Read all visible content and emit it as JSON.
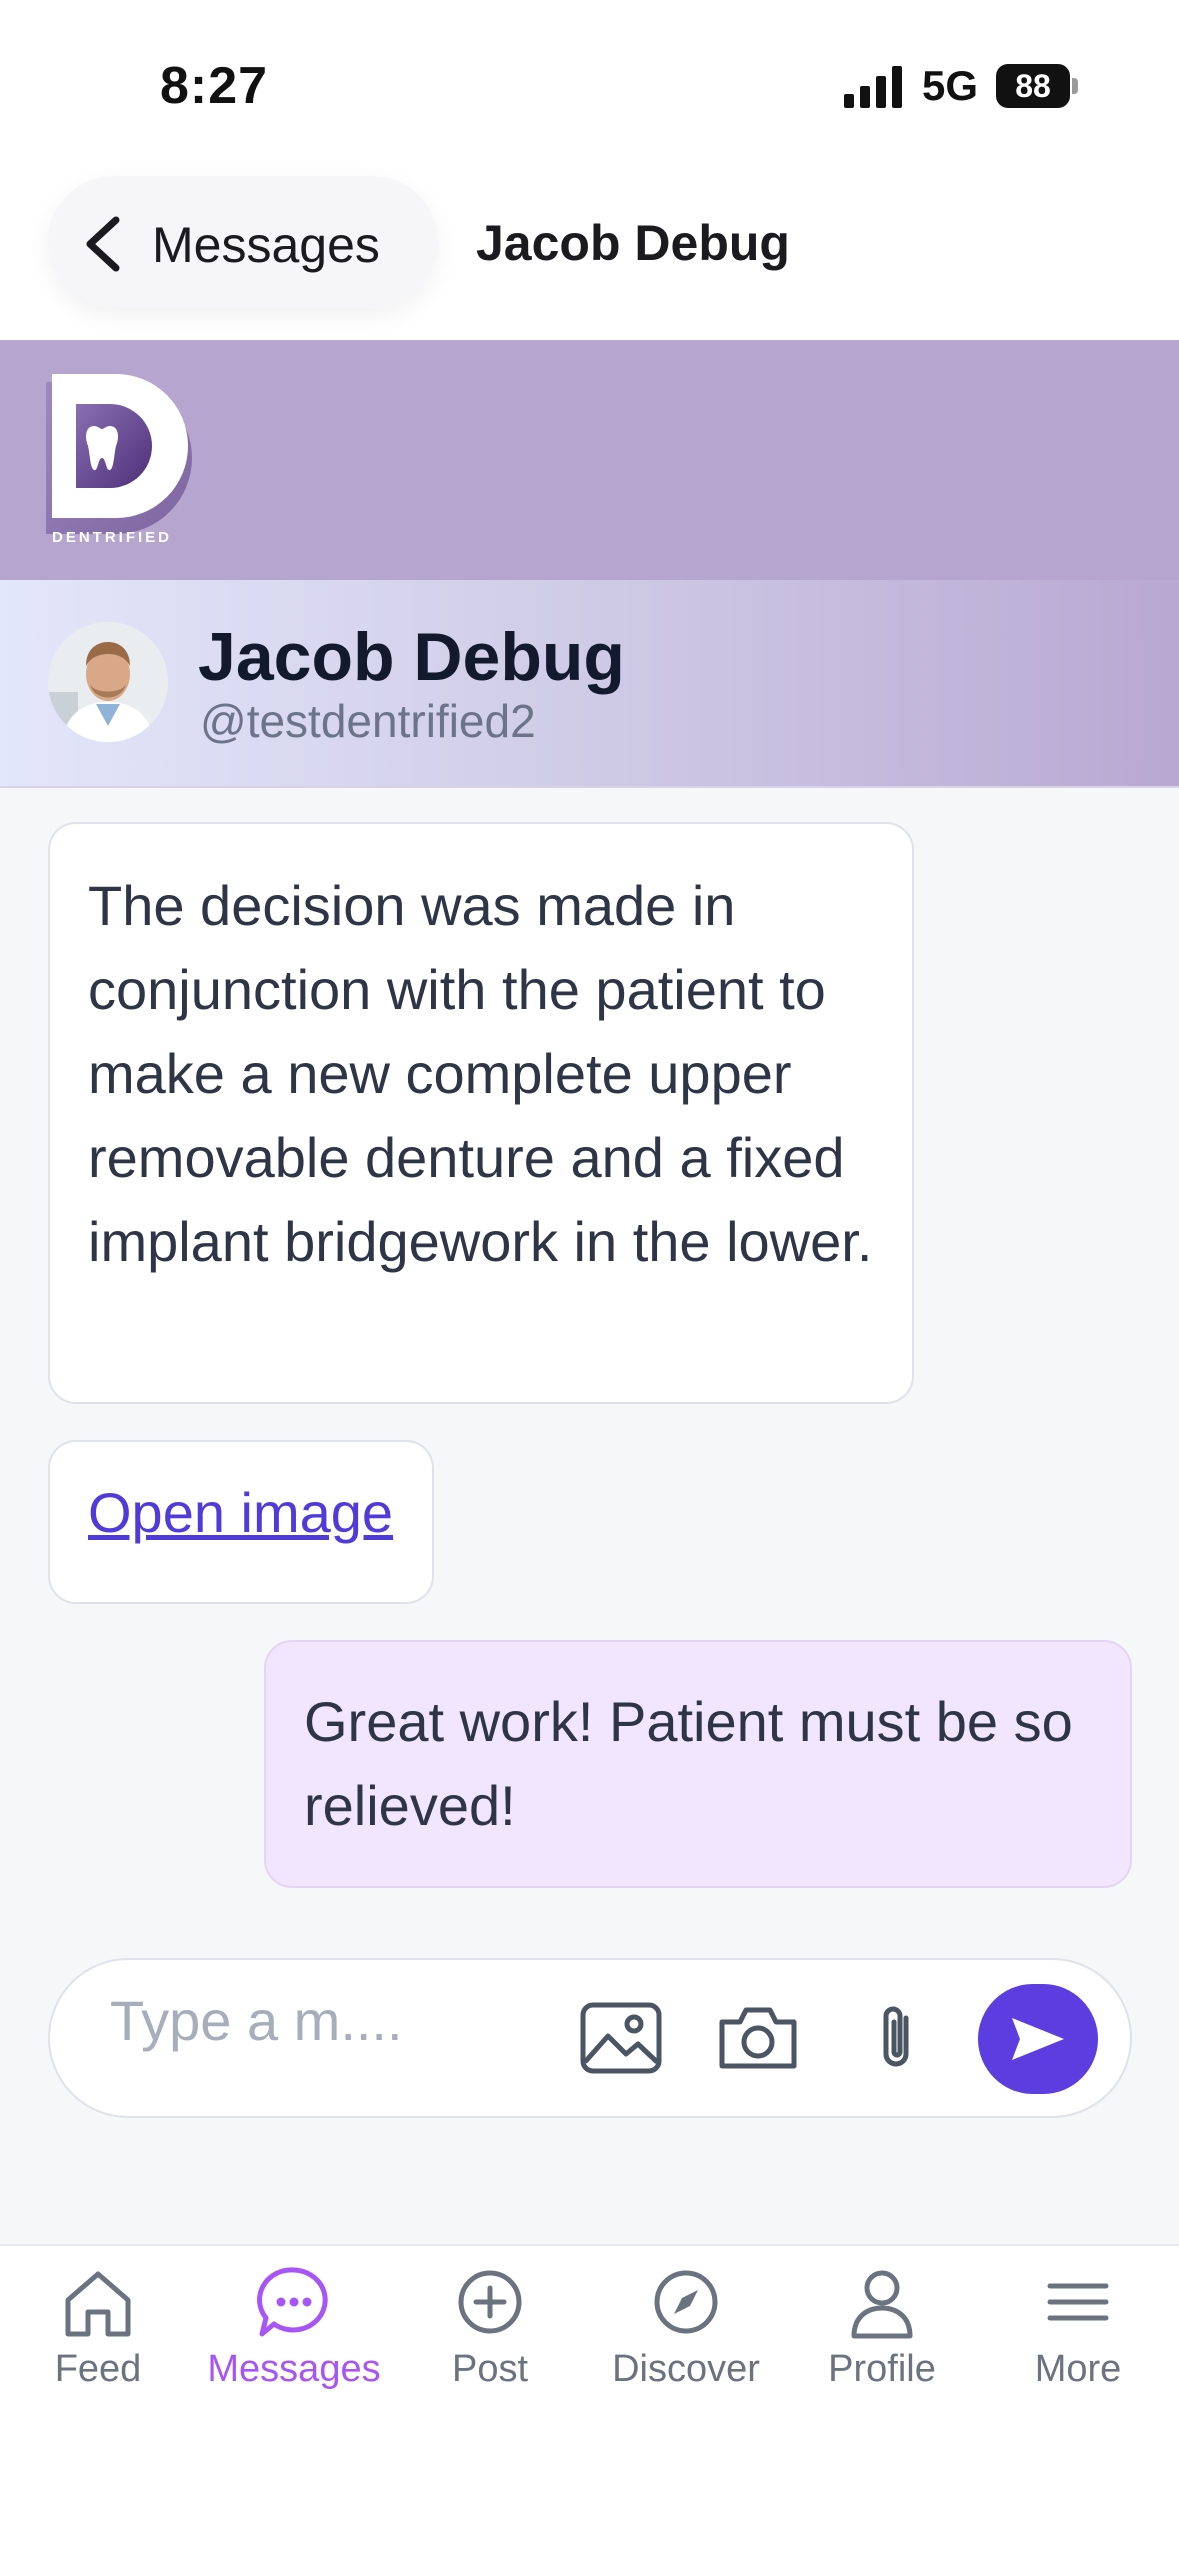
{
  "status_bar": {
    "time": "8:27",
    "network": "5G",
    "battery": "88"
  },
  "header": {
    "back_label": "Messages",
    "title": "Jacob Debug"
  },
  "brand": {
    "logo_text": "DENTRIFIED"
  },
  "profile": {
    "name": "Jacob Debug",
    "handle": "@testdentrified2"
  },
  "messages": [
    {
      "direction": "incoming",
      "text": "The decision was made in conjunction with the patient to make a new complete upper removable denture and a fixed implant bridgework in the lower."
    },
    {
      "direction": "incoming",
      "link_text": "Open image"
    },
    {
      "direction": "outgoing",
      "text": "Great work!  Patient must be so relieved!"
    }
  ],
  "composer": {
    "placeholder": "Type a m...."
  },
  "tabs": [
    {
      "label": "Feed",
      "icon": "home-icon"
    },
    {
      "label": "Messages",
      "icon": "chat-bubble-icon",
      "active": true
    },
    {
      "label": "Post",
      "icon": "plus-circle-icon"
    },
    {
      "label": "Discover",
      "icon": "compass-icon"
    },
    {
      "label": "Profile",
      "icon": "user-icon"
    },
    {
      "label": "More",
      "icon": "menu-icon"
    }
  ],
  "colors": {
    "accent": "#a855f7",
    "send": "#5b3de0",
    "link": "#4f3bd9",
    "banner": "#b6a6cf",
    "outgoing_bubble": "#f1e6fd"
  }
}
